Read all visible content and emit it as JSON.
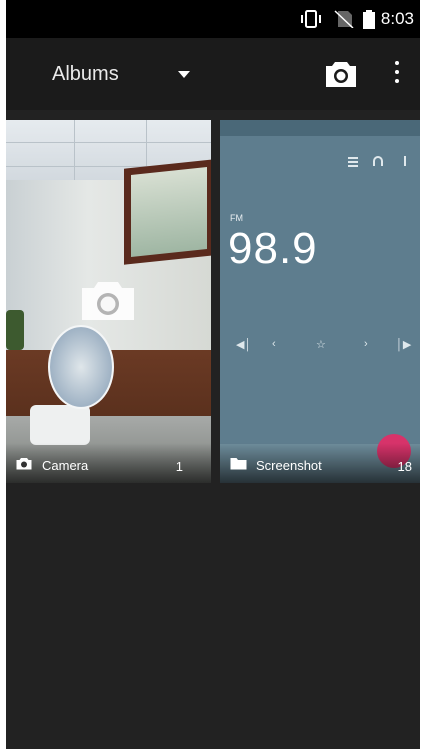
{
  "statusbar": {
    "time": "8:03"
  },
  "appbar": {
    "title": "Albums",
    "icons": [
      "chevron-down-icon",
      "camera-icon",
      "more-vert-icon"
    ]
  },
  "albums": [
    {
      "name": "Camera",
      "count": "1",
      "icon": "camera-icon"
    },
    {
      "name": "Screenshot",
      "count": "18",
      "icon": "folder-icon",
      "preview": {
        "band": "FM",
        "frequency": "98.9"
      }
    }
  ],
  "colors": {
    "background": "#222222",
    "appbar": "#1b1b1b",
    "accent": "#d7336a",
    "screenshot_tile": "#5e7d8e"
  }
}
